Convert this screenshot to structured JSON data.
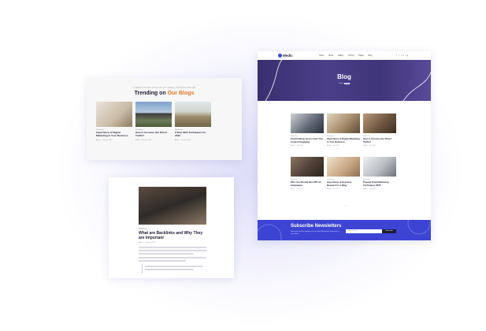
{
  "colors": {
    "accent": "#3d44d4",
    "orange": "#e8762b",
    "dark": "#1d1d35"
  },
  "trending": {
    "eyebrow": "LOREM IPSUM DOLOR SIT AMET CONSECTETUR",
    "heading_pre": "Trending on ",
    "heading_accent": "Our Blogs",
    "posts": [
      {
        "tag": "Marketing",
        "title": "Importance of Digital Marketing in Your Business",
        "author": "Admin",
        "date": "January 2023"
      },
      {
        "tag": "Marketing",
        "title": "How to Increase Our Direct Traffic?",
        "author": "Admin",
        "date": "January 2023"
      },
      {
        "tag": "Marketing",
        "title": "9 Best SEO Techniques for 2022",
        "author": "Admin",
        "date": "January 2023"
      }
    ]
  },
  "article": {
    "category": "Marketing",
    "title": "What are Backlinks and Why They are Important",
    "meta": "Admin  ·  January 2023"
  },
  "blog": {
    "logo": "Medic",
    "menu": [
      "Home",
      "About",
      "Gallery",
      "Pricing",
      "Pages",
      "Blog"
    ],
    "social": "f t in ig",
    "hero_title": "Blog",
    "crumb_home": "Home",
    "crumb_current": "Blog",
    "posts": [
      {
        "tag": "Marketing",
        "title": "Proofreading: Here's How Your Content Engaging",
        "author": "Admin",
        "date": "Jan 2023"
      },
      {
        "tag": "Marketing",
        "title": "Importance of Digital Marketing in Your Business",
        "author": "Admin",
        "date": "Jan 2023"
      },
      {
        "tag": "Marketing",
        "title": "How to Increase Our Direct Traffic?",
        "author": "Admin",
        "date": "Jan 2023"
      },
      {
        "tag": "Marketing",
        "title": "Why You Should Hire PPC for Campaigns",
        "author": "Admin",
        "date": "Jan 2023"
      },
      {
        "tag": "Marketing",
        "title": "Importance of Keyword Research in a Blog",
        "author": "Admin",
        "date": "Jan 2023"
      },
      {
        "tag": "Marketing",
        "title": "Popular Email Marketing Techniques 2022",
        "author": "Admin",
        "date": "Jan 2023"
      }
    ],
    "pager": "• • •",
    "subscribe_title": "Subscribe Newsletters",
    "subscribe_desc": "Subscribe and get updates on our latest blog posts delivered to your inbox.",
    "email_placeholder": "Email address",
    "subscribe_button": "Subscribe"
  }
}
